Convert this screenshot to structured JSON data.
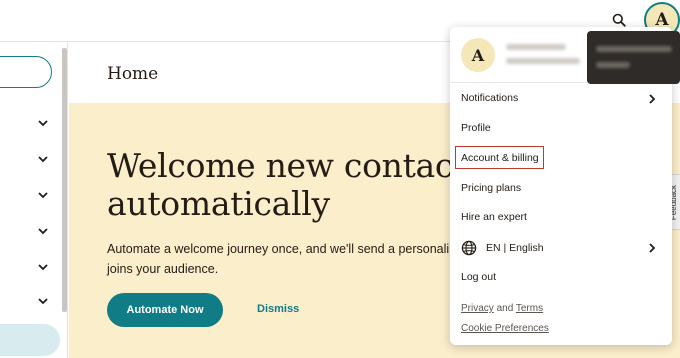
{
  "header": {
    "search_icon": "search-icon",
    "avatar_initial": "A"
  },
  "sidebar": {
    "chevron_icon": "chevron-down-icon"
  },
  "main": {
    "page_title": "Home",
    "hero": {
      "title_line1": "Welcome new contac",
      "title_line2": "automatically",
      "text_line1": "Automate a welcome journey once, and we'll send a personali",
      "text_line2": "joins your audience.",
      "automate_button": "Automate Now",
      "dismiss_button": "Dismiss"
    }
  },
  "feedback_tab": "Feedback",
  "account_menu": {
    "avatar_initial": "A",
    "items": {
      "notifications": "Notifications",
      "profile": "Profile",
      "account_billing": "Account & billing",
      "pricing_plans": "Pricing plans",
      "hire_expert": "Hire an expert",
      "language": "EN | English",
      "log_out": "Log out"
    },
    "footer": {
      "privacy": "Privacy",
      "and": "and",
      "terms": "Terms",
      "cookie_preferences": "Cookie Preferences"
    }
  },
  "colors": {
    "accent": "#0f7c86",
    "hero_bg": "#fbeecb",
    "highlight": "#c0392b"
  }
}
